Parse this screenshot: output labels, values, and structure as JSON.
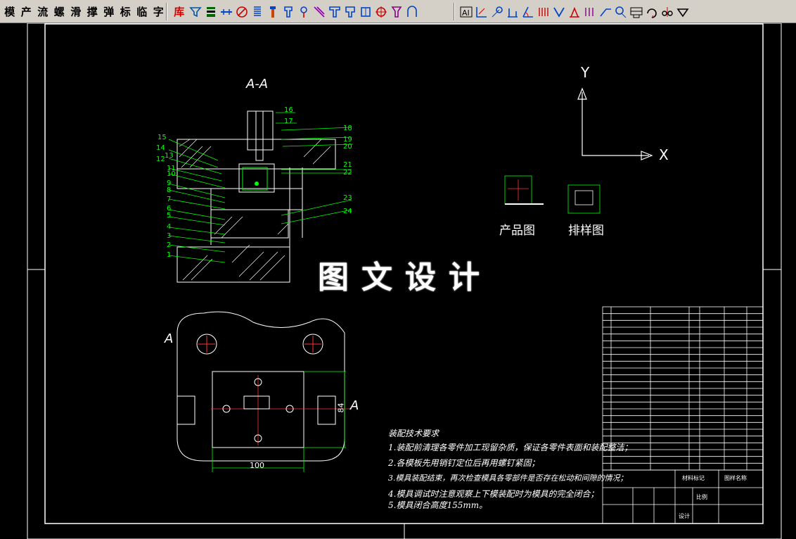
{
  "toolbar": {
    "commands": [
      {
        "label": "模",
        "name": "mold-command"
      },
      {
        "label": "产",
        "name": "product-command"
      },
      {
        "label": "流",
        "name": "flow-channel-command"
      },
      {
        "label": "螺",
        "name": "screw-command"
      },
      {
        "label": "滑",
        "name": "slide-command"
      },
      {
        "label": "撑",
        "name": "support-command"
      },
      {
        "label": "弹",
        "name": "spring-command"
      },
      {
        "label": "标",
        "name": "standard-command"
      },
      {
        "label": "临",
        "name": "temporary-command"
      },
      {
        "label": "字",
        "name": "text-command"
      }
    ],
    "library_label": "库"
  },
  "drawing": {
    "section_label": "A-A",
    "view_label": "A",
    "arrow_label": "A",
    "part_numbers": [
      "1",
      "2",
      "3",
      "4",
      "5",
      "6",
      "7",
      "8",
      "9",
      "10",
      "11",
      "12",
      "13",
      "14",
      "15",
      "16",
      "17",
      "18",
      "19",
      "20",
      "21",
      "22",
      "23",
      "24"
    ],
    "dimension_width": "100",
    "dimension_height": "84",
    "product_label": "产品图",
    "layout_label": "排样图",
    "axis_y": "Y",
    "axis_x": "X",
    "watermark": "图文设计",
    "tech_title": "装配技术要求",
    "tech_items": [
      "1.装配前清理各零件加工现留杂质，保证各零件表面和装配整洁；",
      "2.各模板先用销钉定位后再用螺钉紧固；",
      "3.模具装配结束，再次检查模具各零部件是否存在松动和间隙的情况；",
      "4.模具调试时注意观察上下模装配时为模具的完全闭合；",
      "5.模具闭合高度155mm。"
    ],
    "title_block": {
      "material_label": "材料标记",
      "drawing_name": "图样名称",
      "scale_label": "比例",
      "designer": "设计"
    }
  }
}
